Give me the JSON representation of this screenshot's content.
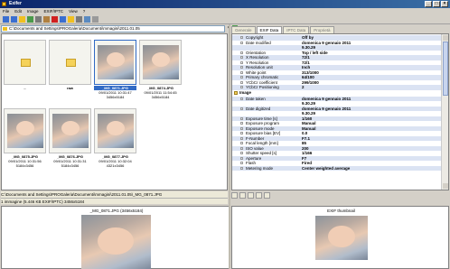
{
  "window": {
    "title": "Exifer",
    "buttons": [
      "_",
      "□",
      "×"
    ]
  },
  "menu": [
    "File",
    "Edit",
    "Image",
    "EXIF/IPTC",
    "View",
    "?"
  ],
  "address": {
    "path": "C:\\Documents and Settings\\PROGaleria\\Documenti\\mmagini\\2011.01.05"
  },
  "thumbnails": [
    {
      "type": "folder",
      "name": "..",
      "sub": "",
      "selected": false
    },
    {
      "type": "folder",
      "name": "raw",
      "sub": "",
      "selected": false
    },
    {
      "type": "image",
      "name": "_MG_0871.JPG",
      "date": "09/01/2011 10:31:47",
      "size": "3456x5184",
      "selected": true
    },
    {
      "type": "image",
      "name": "_MG_0874.JPG",
      "date": "09/01/2011 11:54:45",
      "size": "3456x5184",
      "selected": false
    },
    {
      "type": "image",
      "name": "_MG_0875.JPG",
      "date": "09/01/2011 10:31:56",
      "size": "5184x3456",
      "selected": false
    },
    {
      "type": "image",
      "name": "_MG_0876.JPG",
      "date": "09/01/2011 10:31:31",
      "size": "5184x3456",
      "selected": false
    },
    {
      "type": "image",
      "name": "_MG_0877.JPG",
      "date": "09/01/2011 10:32:04",
      "size": "4321x3456",
      "selected": false
    }
  ],
  "pathbar": "C:\\Documents and Settings\\PROGaleria\\Documenti\\mmagini\\2011.01.05\\_MG_0871.JPG",
  "statusbar": "1 immagine (5.446 KB EXIF/IPTC)   3456x5184",
  "preview": {
    "title": "_MG_0871.JPG (3456x5184)"
  },
  "tabs": [
    "Generale",
    "EXIF Data",
    "IPTC Data",
    "Proprietà"
  ],
  "exif_rows": [
    {
      "k": "Copyright",
      "v": "Off by"
    },
    {
      "k": "Date modified",
      "v": "domenica 9 gennaio 2011"
    },
    {
      "k": "",
      "v": "9.30.29"
    },
    {
      "k": "Orientation",
      "v": "Top / left side"
    },
    {
      "k": "X Resolution",
      "v": "72/1"
    },
    {
      "k": "Y Resolution",
      "v": "72/1"
    },
    {
      "k": "Resolution unit",
      "v": "Inch"
    },
    {
      "k": "White point",
      "v": "313/1000"
    },
    {
      "k": "Primary chromatic",
      "v": "64/100"
    },
    {
      "k": "YCbCr coefficient",
      "v": "299/1000"
    },
    {
      "k": "YCbCr Positioning",
      "v": "2"
    }
  ],
  "image_group": "Image",
  "image_rows": [
    {
      "k": "Date taken",
      "v": "domenica 9 gennaio 2011"
    },
    {
      "k": "",
      "v": "9.30.29"
    },
    {
      "k": "Date digitized",
      "v": "domenica 9 gennaio 2011"
    },
    {
      "k": "",
      "v": "9.30.29"
    },
    {
      "k": "Exposure time [s]",
      "v": "1/160"
    },
    {
      "k": "Exposure program",
      "v": "Manual"
    },
    {
      "k": "Exposure mode",
      "v": "Manual"
    },
    {
      "k": "Exposure bias [EV]",
      "v": "0.0"
    },
    {
      "k": "F-Number",
      "v": "F7.1"
    },
    {
      "k": "Focal length [mm]",
      "v": "85"
    },
    {
      "k": "ISO value",
      "v": "200"
    },
    {
      "k": "Shutter speed [s]",
      "v": "1/166"
    },
    {
      "k": "Aperture",
      "v": "F7"
    },
    {
      "k": "Flash",
      "v": "Fired"
    },
    {
      "k": "Metering mode",
      "v": "Center weighted average"
    }
  ],
  "exif_thumbnail": {
    "title": "EXIF thumbnail"
  }
}
